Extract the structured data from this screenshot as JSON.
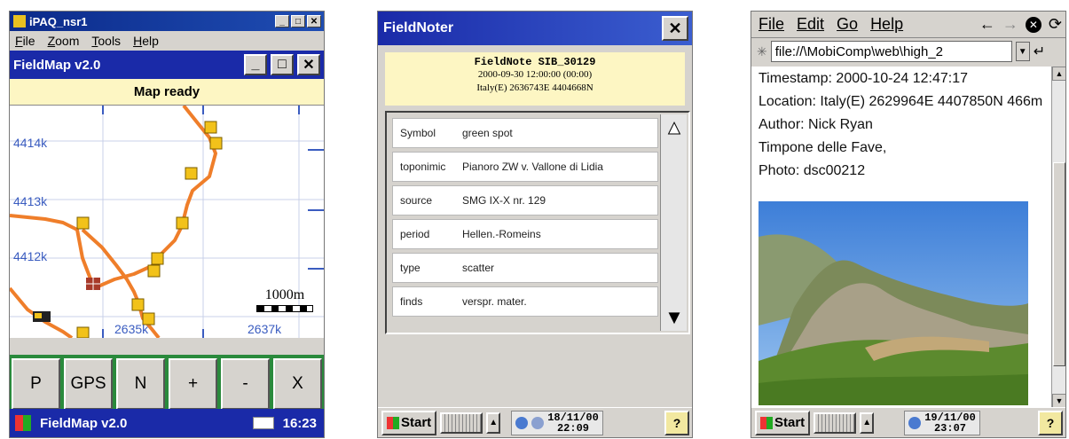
{
  "fieldmap": {
    "window_title": "iPAQ_nsr1",
    "menu": [
      "File",
      "Zoom",
      "Tools",
      "Help"
    ],
    "app_title": "FieldMap v2.0",
    "status": "Map ready",
    "y_ticks": [
      "4414k",
      "4413k",
      "4412k"
    ],
    "x_ticks": [
      "2635k",
      "2637k"
    ],
    "scale_label": "1000m",
    "buttons": [
      "P",
      "GPS",
      "N",
      "+",
      "-",
      "X"
    ],
    "taskbar_title": "FieldMap v2.0",
    "taskbar_time": "16:23"
  },
  "fieldnoter": {
    "title": "FieldNoter",
    "close_label": "✕",
    "note_title": "FieldNote SIB_30129",
    "note_datetime": "2000-09-30 12:00:00 (00:00)",
    "note_location": "Italy(E) 2636743E 4404668N",
    "rows": [
      {
        "key": "Symbol",
        "value": "green spot"
      },
      {
        "key": "toponimic",
        "value": "Pianoro ZW v. Vallone di Lidia"
      },
      {
        "key": "source",
        "value": "SMG IX-X nr. 129"
      },
      {
        "key": "period",
        "value": "Hellen.-Romeins"
      },
      {
        "key": "type",
        "value": "scatter"
      },
      {
        "key": "finds",
        "value": "verspr. mater."
      }
    ],
    "taskbar": {
      "start": "Start",
      "date": "18/11/00",
      "time": "22:09"
    }
  },
  "browser": {
    "menu": [
      "File",
      "Edit",
      "Go",
      "Help"
    ],
    "address": "file://\\MobiComp\\web\\high_2",
    "lines": [
      "Timestamp: 2000-10-24 12:47:17",
      "Location: Italy(E) 2629964E 4407850N 466m",
      "Author: Nick Ryan",
      "Timpone delle Fave,",
      "Photo: dsc00212"
    ],
    "taskbar": {
      "start": "Start",
      "date": "19/11/00",
      "time": "23:07"
    }
  }
}
